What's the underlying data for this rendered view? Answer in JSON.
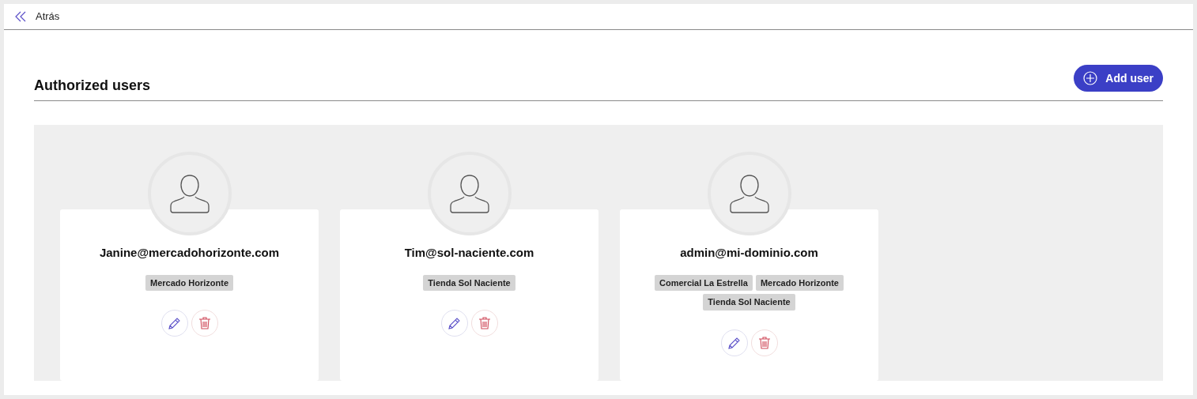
{
  "back_link": "Atrás",
  "section": {
    "title": "Authorized users",
    "add_button": "Add user"
  },
  "users": [
    {
      "email": "Janine@mercadohorizonte.com",
      "stores": [
        "Mercado Horizonte"
      ]
    },
    {
      "email": "Tim@sol-naciente.com",
      "stores": [
        "Tienda Sol Naciente"
      ]
    },
    {
      "email": "admin@mi-dominio.com",
      "stores": [
        "Comercial La Estrella",
        "Mercado Horizonte",
        "Tienda Sol Naciente"
      ]
    }
  ]
}
